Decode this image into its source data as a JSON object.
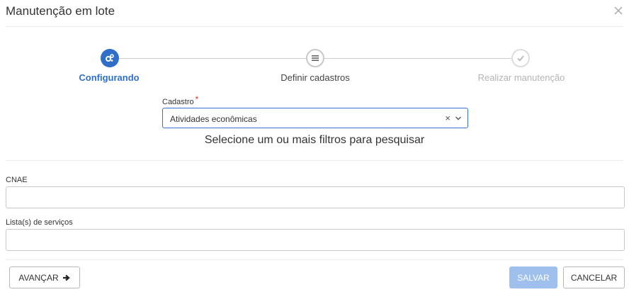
{
  "modal": {
    "title": "Manutenção em lote",
    "close_icon": "close-icon"
  },
  "stepper": {
    "steps": [
      {
        "label": "Configurando",
        "state": "active",
        "icon": "gears-icon"
      },
      {
        "label": "Definir cadastros",
        "state": "pending",
        "icon": "list-icon"
      },
      {
        "label": "Realizar manutenção",
        "state": "disabled",
        "icon": "check-icon"
      }
    ],
    "active_color": "#2f6fc9"
  },
  "cadastro": {
    "label": "Cadastro",
    "required_mark": "*",
    "value": "Atividades econômicas",
    "clear_glyph": "×"
  },
  "hint": "Selecione um ou mais filtros para pesquisar",
  "filters": [
    {
      "label": "CNAE",
      "value": ""
    },
    {
      "label": "Lista(s) de serviços",
      "value": ""
    }
  ],
  "footer": {
    "advance_label": "AVANÇAR",
    "save_label": "SALVAR",
    "cancel_label": "CANCELAR"
  }
}
